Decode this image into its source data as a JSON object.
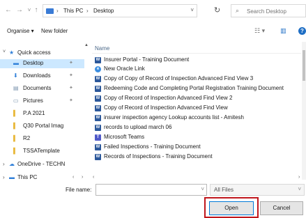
{
  "address": {
    "crumbs": [
      "This PC",
      "Desktop"
    ],
    "separator": "›",
    "back": "←",
    "forward": "→",
    "recent": "˅",
    "up": "↑",
    "dropdown": "˅",
    "refresh": "↻"
  },
  "search": {
    "placeholder": "Search Desktop",
    "icon": "⌕"
  },
  "toolbar": {
    "organise": "Organise ▾",
    "new_folder": "New folder",
    "view_icon": "☷ ▾",
    "pane_icon": "▥",
    "help": "?"
  },
  "nav": {
    "items": [
      {
        "label": "Quick access",
        "icon": "★",
        "expander": "˅"
      },
      {
        "label": "Desktop",
        "icon": "▬",
        "pin": "✦"
      },
      {
        "label": "Downloads",
        "icon": "⬇",
        "pin": "✦"
      },
      {
        "label": "Documents",
        "icon": "▤",
        "pin": "✦"
      },
      {
        "label": "Pictures",
        "icon": "▭",
        "pin": "✦"
      },
      {
        "label": "P.A 2021",
        "icon": "▌"
      },
      {
        "label": "Q30 Portal Imag",
        "icon": "▌"
      },
      {
        "label": "R2",
        "icon": "▌"
      },
      {
        "label": "TSSATemplate",
        "icon": "▌"
      },
      {
        "label": "OneDrive - TECHN",
        "icon": "☁",
        "expander": "›"
      },
      {
        "label": "This PC",
        "icon": "▬",
        "expander": "›"
      }
    ],
    "scroll_up": "▲"
  },
  "files": {
    "column": "Name",
    "rows": [
      {
        "name": "Insurer Portal - Training Document",
        "type": "word",
        "glyph": "W"
      },
      {
        "name": "New Oracle Link",
        "type": "link",
        "glyph": "e"
      },
      {
        "name": "Copy of Copy of Record of Inspection Advanced Find View 3",
        "type": "word",
        "glyph": "W"
      },
      {
        "name": "Redeeming Code and Completing Portal Registration Training Document",
        "type": "word",
        "glyph": "W"
      },
      {
        "name": "Copy of Record of Inspection Advanced Find View 2",
        "type": "word",
        "glyph": "W"
      },
      {
        "name": "Copy of Record of Inspection Advanced Find View",
        "type": "word",
        "glyph": "W"
      },
      {
        "name": "insurer inspection agency Lookup accounts list - Amitesh",
        "type": "word",
        "glyph": "W"
      },
      {
        "name": "records to upload march 06",
        "type": "word",
        "glyph": "W"
      },
      {
        "name": "Microsoft Teams",
        "type": "teams",
        "glyph": "T"
      },
      {
        "name": "Failed Inspections - Training Document",
        "type": "word",
        "glyph": "W"
      },
      {
        "name": "Records of Inspections - Training Document",
        "type": "word",
        "glyph": "W"
      }
    ]
  },
  "hscroll": {
    "left": "‹",
    "right": "›",
    "nav_left": "‹",
    "nav_right": "›"
  },
  "bottom": {
    "file_name_label": "File name:",
    "file_name_value": "",
    "drop": "˅",
    "filter": "All Files",
    "open": "Open",
    "cancel": "Cancel"
  },
  "colors": {
    "highlight": "#c0161c",
    "selected": "#cce8ff",
    "accent": "#0078d7"
  }
}
